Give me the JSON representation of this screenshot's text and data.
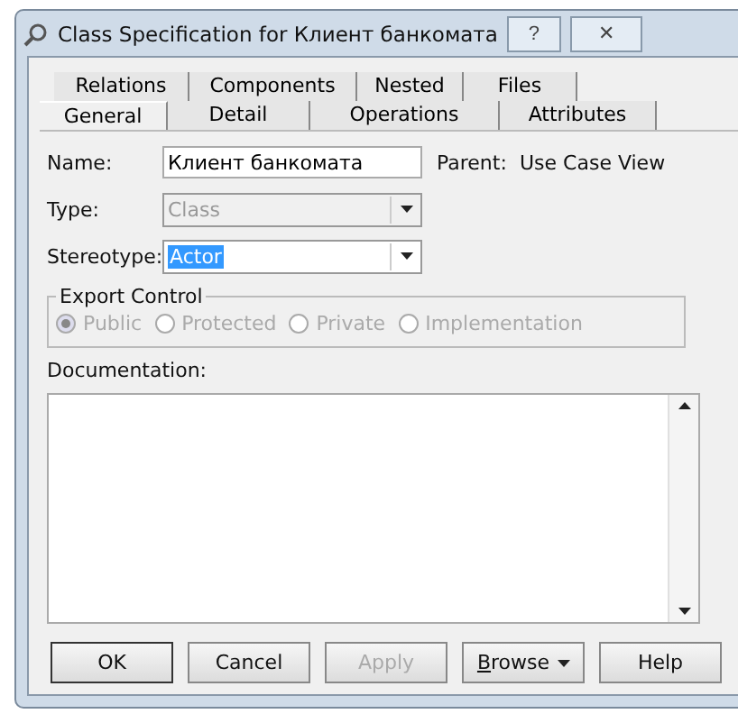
{
  "window": {
    "title": "Class Specification for Клиент  банкомата",
    "help_glyph": "?",
    "close_glyph": "✕"
  },
  "tab_rows": [
    [
      {
        "label": "Relations",
        "selected": false
      },
      {
        "label": "Components",
        "selected": false
      },
      {
        "label": "Nested",
        "selected": false
      },
      {
        "label": "Files",
        "selected": false
      }
    ],
    [
      {
        "label": "General",
        "selected": true
      },
      {
        "label": "Detail",
        "selected": false
      },
      {
        "label": "Operations",
        "selected": false
      },
      {
        "label": "Attributes",
        "selected": false
      }
    ]
  ],
  "name": {
    "label": "Name:",
    "value": "Клиент банкомата"
  },
  "parent": {
    "label": "Parent:",
    "value": "Use Case View"
  },
  "type": {
    "label": "Type:",
    "value": "Class",
    "disabled": true
  },
  "stereotype": {
    "label": "Stereotype:",
    "value": "Actor",
    "disabled": false,
    "highlighted": true
  },
  "export_control": {
    "title": "Export Control",
    "disabled": true,
    "options": [
      {
        "label": "Public",
        "selected": true
      },
      {
        "label": "Protected",
        "selected": false
      },
      {
        "label": "Private",
        "selected": false
      },
      {
        "label": "Implementation",
        "selected": false
      }
    ]
  },
  "documentation": {
    "label": "Documentation:"
  },
  "buttons": [
    {
      "label": "OK",
      "disabled": false,
      "kind": "default"
    },
    {
      "label": "Cancel",
      "disabled": false,
      "kind": "plain"
    },
    {
      "label": "Apply",
      "disabled": true,
      "kind": "plain"
    },
    {
      "label": "Browse",
      "disabled": false,
      "kind": "menu"
    },
    {
      "label": "Help",
      "disabled": false,
      "kind": "plain"
    }
  ]
}
